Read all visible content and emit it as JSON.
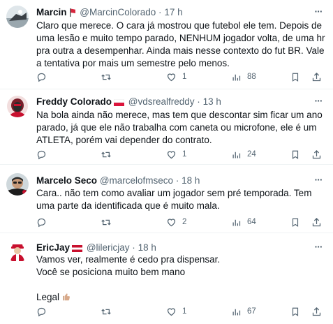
{
  "tweets": [
    {
      "name": "Marcin",
      "handle": "@MarcinColorado",
      "separator": "·",
      "time": "17 h",
      "text": "Claro que merece. O cara já mostrou que futebol ele tem. Depois de uma lesão e muito tempo parado, NENHUM jogador volta, de uma hr pra outra a desempenhar. Ainda mais nesse contexto do fut BR. Vale a tentativa por mais um semestre pelo menos.",
      "replies": "",
      "retweets": "",
      "likes": "1",
      "views": "88",
      "badge_icon": "flag-icon"
    },
    {
      "name": "Freddy Colorado",
      "handle": "@vdsrealfreddy",
      "separator": "·",
      "time": "13 h",
      "text": "Na bola ainda não merece, mas tem que descontar sim ficar um ano parado, já que ele não trabalha com caneta ou microfone, ele é um ATLETA, porém vai depender do contrato.",
      "replies": "",
      "retweets": "",
      "likes": "1",
      "views": "24",
      "badge_icon": "flag-icon"
    },
    {
      "name": "Marcelo Seco",
      "handle": "@marcelofmseco",
      "separator": "·",
      "time": "18 h",
      "text": "Cara.. não tem como avaliar um jogador sem pré temporada. Tem uma parte da identificada que é muito mala.",
      "replies": "",
      "retweets": "",
      "likes": "2",
      "views": "64"
    },
    {
      "name": "EricJay",
      "handle": "@lilericjay",
      "separator": "·",
      "time": "18 h",
      "text": "Vamos ver, realmente é cedo pra dispensar.\nVocê se posiciona muito bem mano\n\nLegal",
      "replies": "",
      "retweets": "",
      "likes": "1",
      "views": "67",
      "badge_icon": "flag-icon",
      "emoji_icon": "thumbs-up-icon"
    }
  ],
  "colors": {
    "text": "#0f1419",
    "muted": "#536471",
    "divider": "#eff3f4",
    "flag_red": "#d7263d"
  },
  "more_label": "···"
}
